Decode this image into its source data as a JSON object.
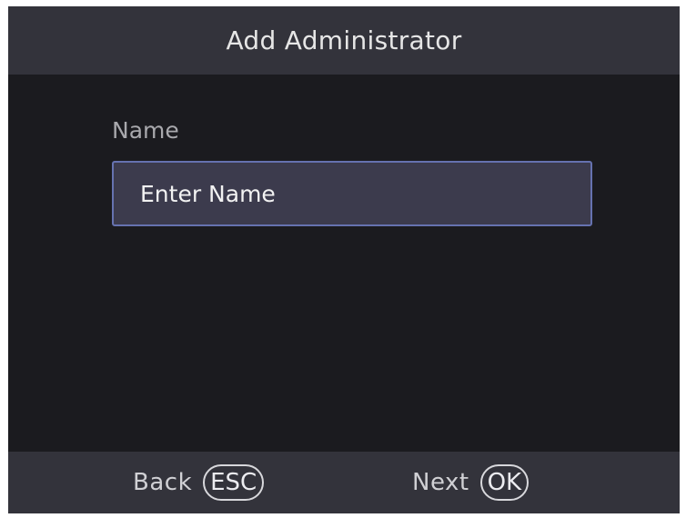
{
  "header": {
    "title": "Add Administrator"
  },
  "form": {
    "name_label": "Name",
    "name_placeholder": "Enter Name"
  },
  "footer": {
    "back_label": "Back",
    "back_key": "ESC",
    "next_label": "Next",
    "next_key": "OK"
  },
  "colors": {
    "background": "#1b1b1f",
    "bar": "#33333b",
    "input_fill": "#3c3b4d",
    "input_border": "#6672b0"
  }
}
